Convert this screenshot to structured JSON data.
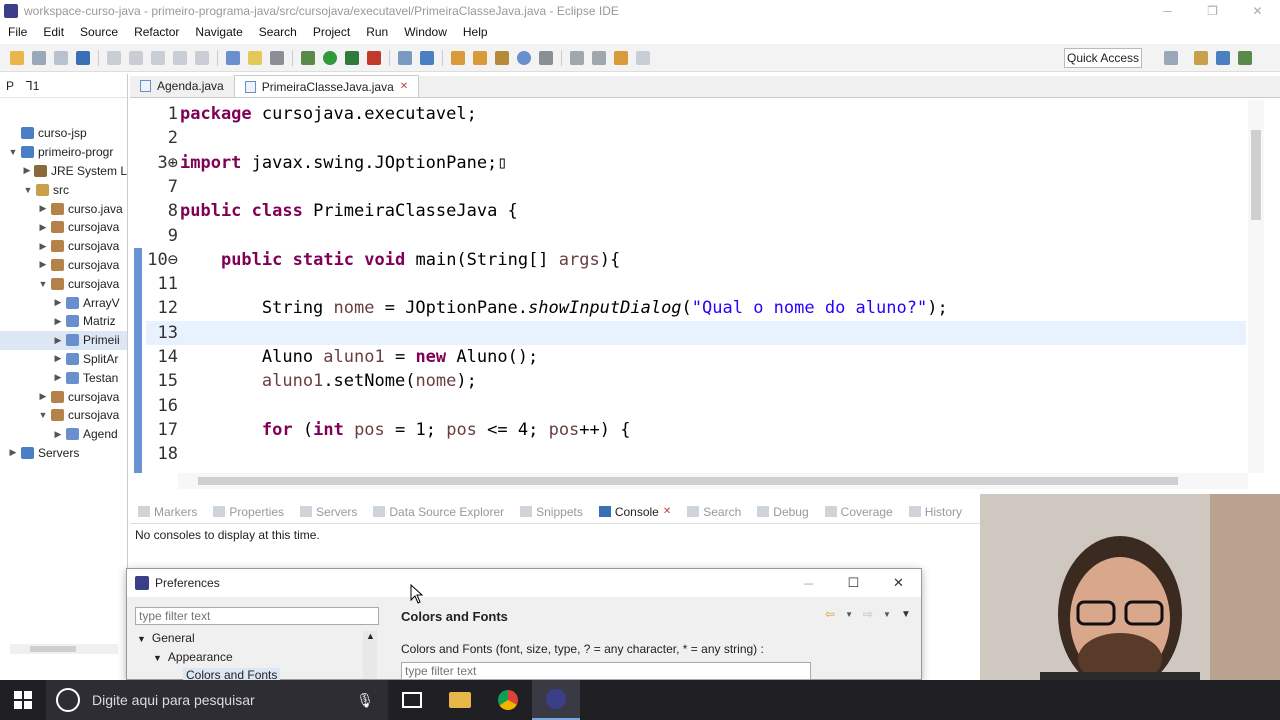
{
  "window": {
    "title": "workspace-curso-java - primeiro-programa-java/src/cursojava/executavel/PrimeiraClasseJava.java - Eclipse IDE",
    "controls": [
      "─",
      "❐",
      "✕"
    ]
  },
  "menu": [
    "File",
    "Edit",
    "Source",
    "Refactor",
    "Navigate",
    "Search",
    "Project",
    "Run",
    "Window",
    "Help"
  ],
  "toolbar": {
    "quick_access": "Quick Access"
  },
  "explorer": {
    "tabs": [
      "P",
      "⅂1"
    ],
    "items": [
      {
        "label": "curso-jsp",
        "depth": 0,
        "tw": "",
        "color": "#4a7fc7"
      },
      {
        "label": "primeiro-progr",
        "depth": 0,
        "tw": "▼",
        "color": "#4a7fc7"
      },
      {
        "label": "JRE System L",
        "depth": 1,
        "tw": "▶",
        "color": "#8a6a3a"
      },
      {
        "label": "src",
        "depth": 1,
        "tw": "▼",
        "color": "#c9a04a"
      },
      {
        "label": "curso.java",
        "depth": 2,
        "tw": "▶",
        "color": "#b5824a"
      },
      {
        "label": "cursojava",
        "depth": 2,
        "tw": "▶",
        "color": "#b5824a"
      },
      {
        "label": "cursojava",
        "depth": 2,
        "tw": "▶",
        "color": "#b5824a"
      },
      {
        "label": "cursojava",
        "depth": 2,
        "tw": "▶",
        "color": "#b5824a"
      },
      {
        "label": "cursojava",
        "depth": 2,
        "tw": "▼",
        "color": "#b5824a"
      },
      {
        "label": "ArrayV",
        "depth": 3,
        "tw": "▶",
        "color": "#6a8fcf"
      },
      {
        "label": "Matriz",
        "depth": 3,
        "tw": "▶",
        "color": "#6a8fcf"
      },
      {
        "label": "Primeii",
        "depth": 3,
        "tw": "▶",
        "color": "#6a8fcf",
        "selected": true
      },
      {
        "label": "SplitAr",
        "depth": 3,
        "tw": "▶",
        "color": "#6a8fcf"
      },
      {
        "label": "Testan",
        "depth": 3,
        "tw": "▶",
        "color": "#6a8fcf"
      },
      {
        "label": "cursojava",
        "depth": 2,
        "tw": "▶",
        "color": "#b5824a"
      },
      {
        "label": "cursojava",
        "depth": 2,
        "tw": "▼",
        "color": "#b5824a"
      },
      {
        "label": "Agend",
        "depth": 3,
        "tw": "▶",
        "color": "#6a8fcf"
      },
      {
        "label": "Servers",
        "depth": 0,
        "tw": "▶",
        "color": "#4a7fc7"
      }
    ]
  },
  "editor": {
    "tabs": [
      {
        "label": "Agenda.java",
        "active": false
      },
      {
        "label": "PrimeiraClasseJava.java",
        "active": true,
        "close": "✕"
      }
    ],
    "lines": [
      {
        "n": "1",
        "html": "<span class='kw'>package</span> cursojava.executavel;"
      },
      {
        "n": "2",
        "html": ""
      },
      {
        "n": "3⊕",
        "html": "<span class='kw'>import</span> javax.swing.JOptionPane;▯"
      },
      {
        "n": "7",
        "html": ""
      },
      {
        "n": "8",
        "html": "<span class='kw'>public</span> <span class='kw'>class</span> PrimeiraClasseJava {"
      },
      {
        "n": "9",
        "html": ""
      },
      {
        "n": "10⊖",
        "html": "    <span class='kw'>public</span> <span class='kw'>static</span> <span class='kw'>void</span> main(String[] <span class='var'>args</span>){"
      },
      {
        "n": "11",
        "html": ""
      },
      {
        "n": "12",
        "html": "        String <span class='var'>nome</span> = JOptionPane.<span class='it'>showInputDialog</span>(<span class='str'>\"Qual o nome do aluno?\"</span>);"
      },
      {
        "n": "13",
        "html": "",
        "current": true
      },
      {
        "n": "14",
        "html": "        Aluno <span class='var'>aluno1</span> = <span class='kw'>new</span> Aluno();"
      },
      {
        "n": "15",
        "html": "        <span class='var'>aluno1</span>.setNome(<span class='var'>nome</span>);"
      },
      {
        "n": "16",
        "html": ""
      },
      {
        "n": "17",
        "html": "        <span class='kw'>for</span> (<span class='kw'>int</span> <span class='var'>pos</span> = 1; <span class='var'>pos</span> &lt;= 4; <span class='var'>pos</span>++) {"
      },
      {
        "n": "18",
        "html": ""
      }
    ]
  },
  "bottom_panel": {
    "tabs": [
      {
        "label": "Markers",
        "active": false
      },
      {
        "label": "Properties",
        "active": false
      },
      {
        "label": "Servers",
        "active": false
      },
      {
        "label": "Data Source Explorer",
        "active": false
      },
      {
        "label": "Snippets",
        "active": false
      },
      {
        "label": "Console",
        "active": true
      },
      {
        "label": "Search",
        "active": false
      },
      {
        "label": "Debug",
        "active": false
      },
      {
        "label": "Coverage",
        "active": false
      },
      {
        "label": "History",
        "active": false
      }
    ],
    "console_message": "No consoles to display at this time."
  },
  "preferences": {
    "title": "Preferences",
    "filter_placeholder": "type filter text",
    "tree": [
      {
        "label": "General",
        "tw": "▼"
      },
      {
        "label": "Appearance",
        "tw": "▼"
      },
      {
        "label": "Colors and Fonts",
        "tw": "",
        "selected": true
      }
    ],
    "page_title": "Colors and Fonts",
    "description": "Colors and Fonts (font, size, type, ? = any character, * = any string) :",
    "filter2_placeholder": "type filter text"
  },
  "taskbar": {
    "search_placeholder": "Digite aqui para pesquisar"
  }
}
